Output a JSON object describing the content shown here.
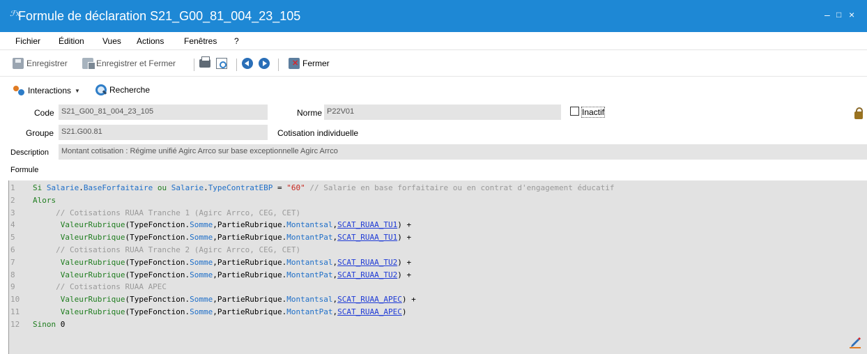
{
  "window": {
    "title": "Formule de déclaration S21_G00_81_004_23_105",
    "icon": "fx-icon",
    "controls": [
      "–",
      "□",
      "×"
    ]
  },
  "menu": [
    "Fichier",
    "Édition",
    "Vues",
    "Actions",
    "Fenêtres",
    "?"
  ],
  "toolbar": {
    "save": "Enregistrer",
    "save_close": "Enregistrer et Fermer",
    "close": "Fermer"
  },
  "toolbar2": {
    "interactions": "Interactions",
    "search": "Recherche"
  },
  "form": {
    "code_label": "Code",
    "code_value": "S21_G00_81_004_23_105",
    "norme_label": "Norme",
    "norme_value": "P22V01",
    "inactif_label": "Inactif",
    "inactif_checked": false,
    "groupe_label": "Groupe",
    "groupe_value": "S21.G00.81",
    "groupe_desc": "Cotisation individuelle",
    "description_label": "Description",
    "description_value": "Montant cotisation : Régime unifié Agirc Arrco sur base exceptionnelle Agirc Arrco",
    "formule_label": "Formule"
  },
  "formula": {
    "lines": [
      {
        "n": "1",
        "tokens": [
          [
            "kw",
            "Si "
          ],
          [
            "obj",
            "Salarie"
          ],
          [
            "blk",
            "."
          ],
          [
            "obj",
            "BaseForfaitaire"
          ],
          [
            "kw",
            " ou "
          ],
          [
            "obj",
            "Salarie"
          ],
          [
            "blk",
            "."
          ],
          [
            "obj",
            "TypeContratEBP"
          ],
          [
            "blk",
            " = "
          ],
          [
            "str",
            "\"60\""
          ],
          [
            "cmt",
            " // Salarie en base forfaitaire ou en contrat d'engagement éducatif"
          ]
        ]
      },
      {
        "n": "2",
        "tokens": [
          [
            "kw",
            "Alors"
          ]
        ]
      },
      {
        "n": "3",
        "tokens": [
          [
            "cmt",
            "     // Cotisations RUAA Tranche 1 (Agirc Arrco, CEG, CET)"
          ]
        ]
      },
      {
        "n": "4",
        "tokens": [
          [
            "fn",
            "      ValeurRubrique"
          ],
          [
            "blk",
            "("
          ],
          [
            "blk",
            "TypeFonction."
          ],
          [
            "obj",
            "Somme"
          ],
          [
            "blk",
            ","
          ],
          [
            "blk",
            "PartieRubrique."
          ],
          [
            "obj",
            "Montantsal"
          ],
          [
            "blk",
            ","
          ],
          [
            "cst",
            "SCAT_RUAA_TU1"
          ],
          [
            "blk",
            ") +"
          ]
        ]
      },
      {
        "n": "5",
        "tokens": [
          [
            "fn",
            "      ValeurRubrique"
          ],
          [
            "blk",
            "("
          ],
          [
            "blk",
            "TypeFonction."
          ],
          [
            "obj",
            "Somme"
          ],
          [
            "blk",
            ","
          ],
          [
            "blk",
            "PartieRubrique."
          ],
          [
            "obj",
            "MontantPat"
          ],
          [
            "blk",
            ","
          ],
          [
            "cst",
            "SCAT_RUAA_TU1"
          ],
          [
            "blk",
            ") +"
          ]
        ]
      },
      {
        "n": "6",
        "tokens": [
          [
            "cmt",
            "     // Cotisations RUAA Tranche 2 (Agirc Arrco, CEG, CET)"
          ]
        ]
      },
      {
        "n": "7",
        "tokens": [
          [
            "fn",
            "      ValeurRubrique"
          ],
          [
            "blk",
            "("
          ],
          [
            "blk",
            "TypeFonction."
          ],
          [
            "obj",
            "Somme"
          ],
          [
            "blk",
            ","
          ],
          [
            "blk",
            "PartieRubrique."
          ],
          [
            "obj",
            "Montantsal"
          ],
          [
            "blk",
            ","
          ],
          [
            "cst",
            "SCAT_RUAA_TU2"
          ],
          [
            "blk",
            ") +"
          ]
        ]
      },
      {
        "n": "8",
        "tokens": [
          [
            "fn",
            "      ValeurRubrique"
          ],
          [
            "blk",
            "("
          ],
          [
            "blk",
            "TypeFonction."
          ],
          [
            "obj",
            "Somme"
          ],
          [
            "blk",
            ","
          ],
          [
            "blk",
            "PartieRubrique."
          ],
          [
            "obj",
            "MontantPat"
          ],
          [
            "blk",
            ","
          ],
          [
            "cst",
            "SCAT_RUAA_TU2"
          ],
          [
            "blk",
            ") +"
          ]
        ]
      },
      {
        "n": "9",
        "tokens": [
          [
            "cmt",
            "     // Cotisations RUAA APEC"
          ]
        ]
      },
      {
        "n": "10",
        "tokens": [
          [
            "fn",
            "      ValeurRubrique"
          ],
          [
            "blk",
            "("
          ],
          [
            "blk",
            "TypeFonction."
          ],
          [
            "obj",
            "Somme"
          ],
          [
            "blk",
            ","
          ],
          [
            "blk",
            "PartieRubrique."
          ],
          [
            "obj",
            "Montantsal"
          ],
          [
            "blk",
            ","
          ],
          [
            "cst",
            "SCAT_RUAA_APEC"
          ],
          [
            "blk",
            ") +"
          ]
        ]
      },
      {
        "n": "11",
        "tokens": [
          [
            "fn",
            "      ValeurRubrique"
          ],
          [
            "blk",
            "("
          ],
          [
            "blk",
            "TypeFonction."
          ],
          [
            "obj",
            "Somme"
          ],
          [
            "blk",
            ","
          ],
          [
            "blk",
            "PartieRubrique."
          ],
          [
            "obj",
            "MontantPat"
          ],
          [
            "blk",
            ","
          ],
          [
            "cst",
            "SCAT_RUAA_APEC"
          ],
          [
            "blk",
            ")"
          ]
        ]
      },
      {
        "n": "12",
        "tokens": [
          [
            "kw",
            "Sinon "
          ],
          [
            "blk",
            "0"
          ]
        ]
      }
    ]
  },
  "colors": {
    "titlebar": "#1e88d5",
    "keyword": "#1f7d1f",
    "object": "#1f6fc8",
    "string": "#c8261e",
    "comment": "#9a9a9a",
    "constant": "#1f3bd6"
  },
  "icons": [
    "save-icon",
    "save-close-icon",
    "print-icon",
    "print-preview-icon",
    "previous-icon",
    "next-icon",
    "close-icon",
    "interactions-icon",
    "search-icon",
    "lock-icon",
    "edit-pencil-icon"
  ]
}
